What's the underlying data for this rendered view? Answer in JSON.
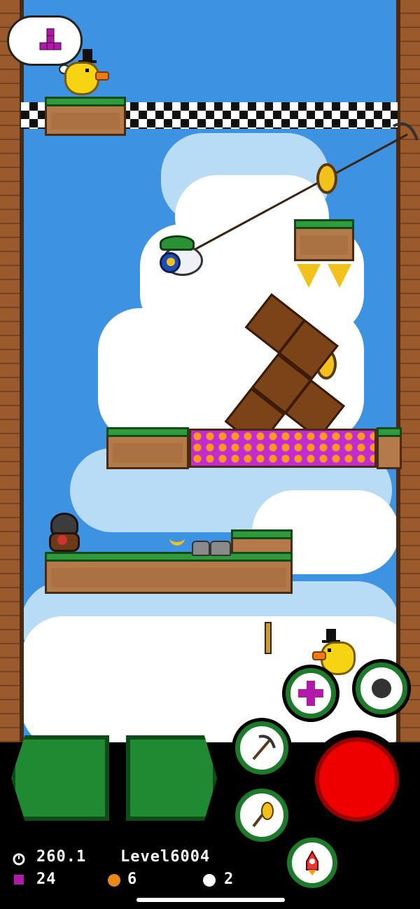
{
  "game": {
    "thought_icon": "tetromino-t-icon",
    "colors": {
      "sky": "#3d93e2",
      "grass": "#2f9b3b",
      "dirt": "#b57a4a",
      "lava": "#c32bd0",
      "action": "#e00000",
      "pad": "#1f8a32"
    }
  },
  "controls": {
    "left_button_icon": "left-arrow-pad",
    "right_button_icon": "right-arrow-pad",
    "actions": [
      {
        "name": "place-block-button",
        "icon": "plus-cross-icon"
      },
      {
        "name": "bomb-button",
        "icon": "bomb-icon"
      },
      {
        "name": "pickaxe-button",
        "icon": "pickaxe-icon"
      },
      {
        "name": "grapple-button",
        "icon": "grappling-hook-icon"
      },
      {
        "name": "rocket-button",
        "icon": "rocket-icon"
      },
      {
        "name": "jump-button",
        "icon": "red-circle"
      }
    ]
  },
  "hud": {
    "timer_icon": "clock-icon",
    "timer": "260.1",
    "level": "Level6004",
    "blocks_icon": "purple-block-icon",
    "blocks": "24",
    "bombs_icon": "orange-orb-icon",
    "bombs": "6",
    "coins_icon": "coin-icon",
    "coins": "2"
  }
}
